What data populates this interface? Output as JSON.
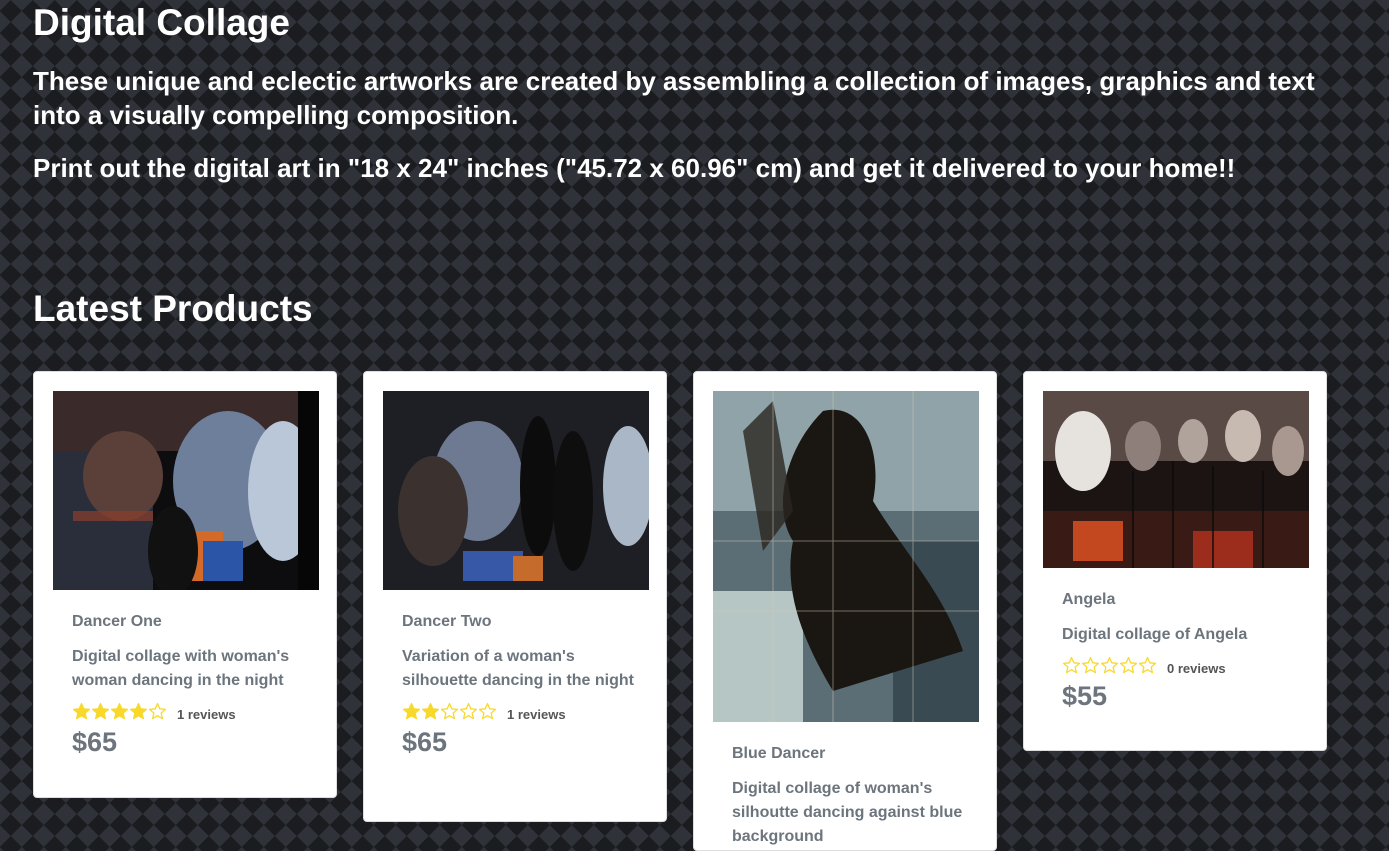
{
  "intro": {
    "title": "Digital Collage",
    "description": "These unique and eclectic artworks are created by assembling a collection of images, graphics and text into a visually compelling composition.",
    "print_note": "Print out the digital art in \"18 x 24\" inches (\"45.72 x 60.96\" cm) and get it delivered to your home!!"
  },
  "latest_heading": "Latest Products",
  "colors": {
    "star": "#f8d82b",
    "text_muted": "#6c757d"
  },
  "products": [
    {
      "name": "Dancer One",
      "description": "Digital collage with woman's woman dancing in the night",
      "rating": 4,
      "reviews": "1 reviews",
      "price": "$65"
    },
    {
      "name": "Dancer Two",
      "description": "Variation of a woman's silhouette dancing in the night",
      "rating": 2,
      "reviews": "1 reviews",
      "price": "$65"
    },
    {
      "name": "Blue Dancer",
      "description": "Digital collage of woman's silhoutte dancing against blue background",
      "rating": null,
      "reviews": "",
      "price": ""
    },
    {
      "name": "Angela",
      "description": "Digital collage of Angela",
      "rating": 0,
      "reviews": "0 reviews",
      "price": "$55"
    }
  ]
}
